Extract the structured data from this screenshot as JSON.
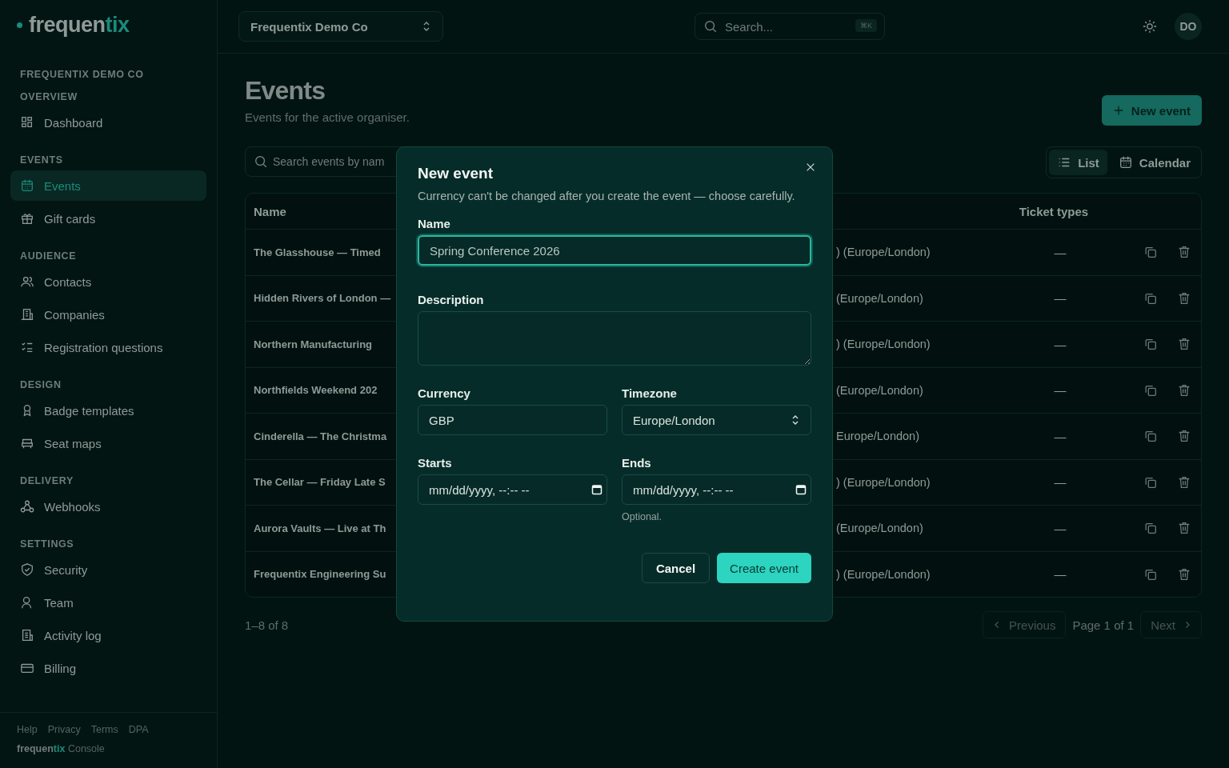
{
  "logo": {
    "main": "frequen",
    "accent": "tix"
  },
  "org_switcher": {
    "label": "Frequentix Demo Co"
  },
  "search": {
    "placeholder": "Search...",
    "shortcut": "⌘K"
  },
  "avatar": {
    "initials": "DO"
  },
  "sidebar": {
    "org": "FREQUENTIX DEMO CO",
    "sections": [
      {
        "title": "OVERVIEW",
        "items": [
          {
            "label": "Dashboard",
            "selected": false
          }
        ]
      },
      {
        "title": "EVENTS",
        "items": [
          {
            "label": "Events",
            "selected": true
          },
          {
            "label": "Gift cards",
            "selected": false
          }
        ]
      },
      {
        "title": "AUDIENCE",
        "items": [
          {
            "label": "Contacts",
            "selected": false
          },
          {
            "label": "Companies",
            "selected": false
          },
          {
            "label": "Registration questions",
            "selected": false
          }
        ]
      },
      {
        "title": "DESIGN",
        "items": [
          {
            "label": "Badge templates",
            "selected": false
          },
          {
            "label": "Seat maps",
            "selected": false
          }
        ]
      },
      {
        "title": "DELIVERY",
        "items": [
          {
            "label": "Webhooks",
            "selected": false
          }
        ]
      },
      {
        "title": "SETTINGS",
        "items": [
          {
            "label": "Security",
            "selected": false
          },
          {
            "label": "Team",
            "selected": false
          },
          {
            "label": "Activity log",
            "selected": false
          },
          {
            "label": "Billing",
            "selected": false
          }
        ]
      }
    ],
    "footer_links": [
      "Help",
      "Privacy",
      "Terms",
      "DPA"
    ],
    "footer_brand": {
      "main": "frequen",
      "accent": "tix",
      "suffix": "Console"
    }
  },
  "page": {
    "title": "Events",
    "subtitle": "Events for the active organiser.",
    "new_button": "New event",
    "filter": {
      "placeholder": "Search events by nam"
    },
    "views": [
      {
        "label": "List",
        "selected": true
      },
      {
        "label": "Calendar",
        "selected": false
      }
    ],
    "table": {
      "columns": [
        "Name",
        "Ticket types"
      ],
      "rows": [
        {
          "name": "The Glasshouse — Timed",
          "date": ") (Europe/London)",
          "tickets": "—"
        },
        {
          "name": "Hidden Rivers of London —",
          "date": "(Europe/London)",
          "tickets": "—"
        },
        {
          "name": "Northern Manufacturing",
          "date": ") (Europe/London)",
          "tickets": "—"
        },
        {
          "name": "Northfields Weekend 202",
          "date": "(Europe/London)",
          "tickets": "—"
        },
        {
          "name": "Cinderella — The Christma",
          "date": "Europe/London)",
          "tickets": "—"
        },
        {
          "name": "The Cellar — Friday Late S",
          "date": ") (Europe/London)",
          "tickets": "—"
        },
        {
          "name": "Aurora Vaults — Live at Th",
          "date": "(Europe/London)",
          "tickets": "—"
        },
        {
          "name": "Frequentix Engineering Su",
          "date": ") (Europe/London)",
          "tickets": "—"
        }
      ]
    },
    "count": "1–8 of 8",
    "pagination": {
      "previous": "Previous",
      "page": "Page 1 of 1",
      "next": "Next"
    }
  },
  "dialog": {
    "title": "New event",
    "description": "Currency can't be changed after you create the event — choose carefully.",
    "name": {
      "label": "Name",
      "value": "Spring Conference 2026"
    },
    "desc": {
      "label": "Description"
    },
    "currency": {
      "label": "Currency",
      "value": "GBP"
    },
    "timezone": {
      "label": "Timezone",
      "value": "Europe/London"
    },
    "starts": {
      "label": "Starts",
      "value": "mm/dd/yyyy, --:-- --"
    },
    "ends": {
      "label": "Ends",
      "value": "mm/dd/yyyy, --:-- --",
      "hint": "Optional."
    },
    "cancel": "Cancel",
    "submit": "Create event"
  }
}
